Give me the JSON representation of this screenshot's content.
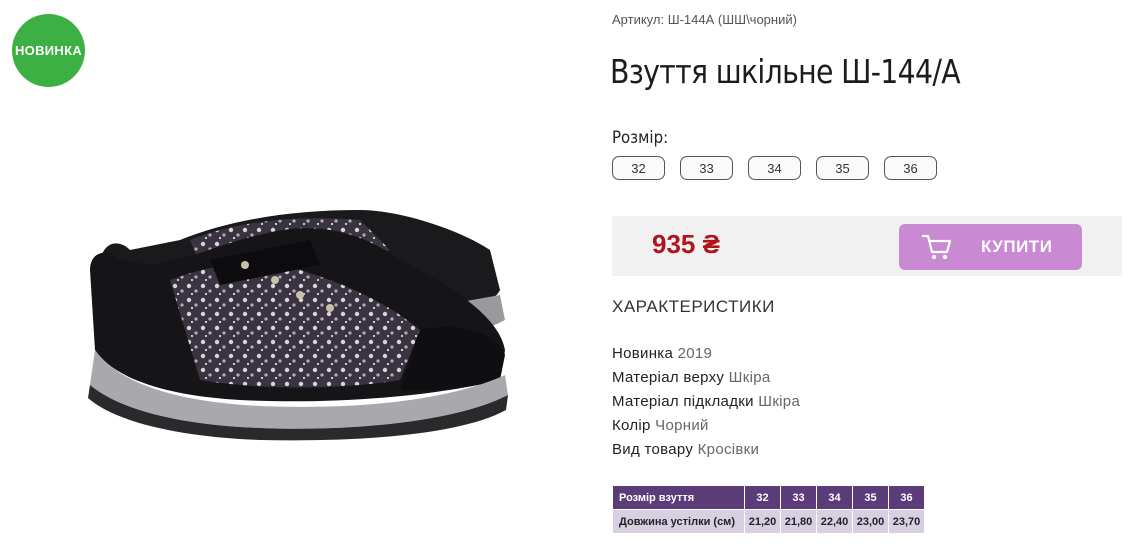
{
  "badge": {
    "label": "НОВИНКА"
  },
  "product": {
    "sku": "Артикул: Ш-144А (ШШ\\чорний)",
    "title": "Взуття шкільне Ш-144/А",
    "size_label": "Розмір:",
    "sizes": [
      "32",
      "33",
      "34",
      "35",
      "36"
    ]
  },
  "buy": {
    "price": "935 ₴",
    "button_label": "КУПИТИ"
  },
  "characteristics": {
    "title": "ХАРАКТЕРИСТИКИ",
    "items": [
      {
        "name": "Новинка",
        "value": "2019"
      },
      {
        "name": "Матеріал верху",
        "value": "Шкіра"
      },
      {
        "name": "Матеріал підкладки",
        "value": "Шкіра"
      },
      {
        "name": "Колір",
        "value": "Чорний"
      },
      {
        "name": "Вид товару",
        "value": "Кросівки"
      }
    ]
  },
  "size_table": {
    "header_label": "Розмір взуття",
    "sizes": [
      "32",
      "33",
      "34",
      "35",
      "36"
    ],
    "row_label": "Довжина устілки (см)",
    "lengths": [
      "21,20",
      "21,80",
      "22,40",
      "23,00",
      "23,70"
    ]
  },
  "colors": {
    "badge_green": "#3cb043",
    "price_red": "#b0141c",
    "buy_button": "#c98ad3",
    "table_header": "#5c3c78",
    "table_row": "#d8d0e2"
  },
  "icons": {
    "cart": "cart-icon"
  }
}
